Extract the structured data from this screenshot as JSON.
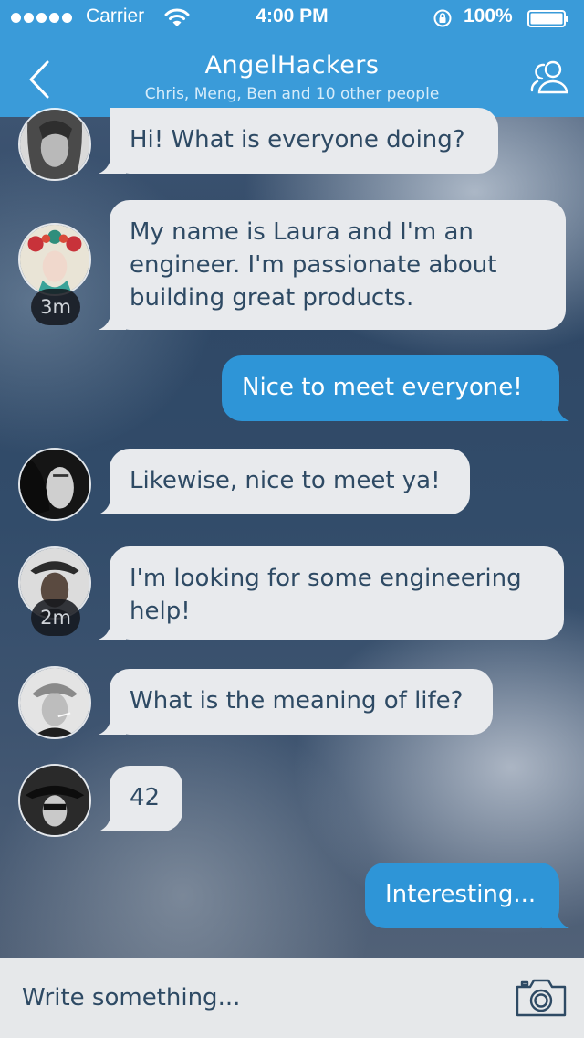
{
  "status_bar": {
    "carrier": "Carrier",
    "time": "4:00 PM",
    "battery": "100%"
  },
  "header": {
    "title": "AngelHackers",
    "subtitle": "Chris, Meng, Ben and 10 other people",
    "back_icon": "chevron-left-icon",
    "people_icon": "people-icon"
  },
  "messages": [
    {
      "direction": "in",
      "text": "Hi! What is everyone doing?",
      "time": ""
    },
    {
      "direction": "in",
      "text": "My name is Laura and I'm an engineer. I'm passionate about building great products.",
      "time": "3m"
    },
    {
      "direction": "out",
      "text": "Nice to meet everyone!",
      "time": ""
    },
    {
      "direction": "in",
      "text": "Likewise, nice to meet ya!",
      "time": ""
    },
    {
      "direction": "in",
      "text": "I'm looking for some engineering help!",
      "time": "2m"
    },
    {
      "direction": "in",
      "text": "What is the meaning of life?",
      "time": ""
    },
    {
      "direction": "in",
      "text": "42",
      "time": ""
    },
    {
      "direction": "out",
      "text": "Interesting...",
      "time": ""
    }
  ],
  "composer": {
    "placeholder": "Write something...",
    "camera_icon": "camera-icon"
  },
  "colors": {
    "accent": "#3a9bd9",
    "outgoing_bubble": "#2e95d7",
    "incoming_bubble": "#e8eaed",
    "incoming_text": "#2e4a64"
  }
}
